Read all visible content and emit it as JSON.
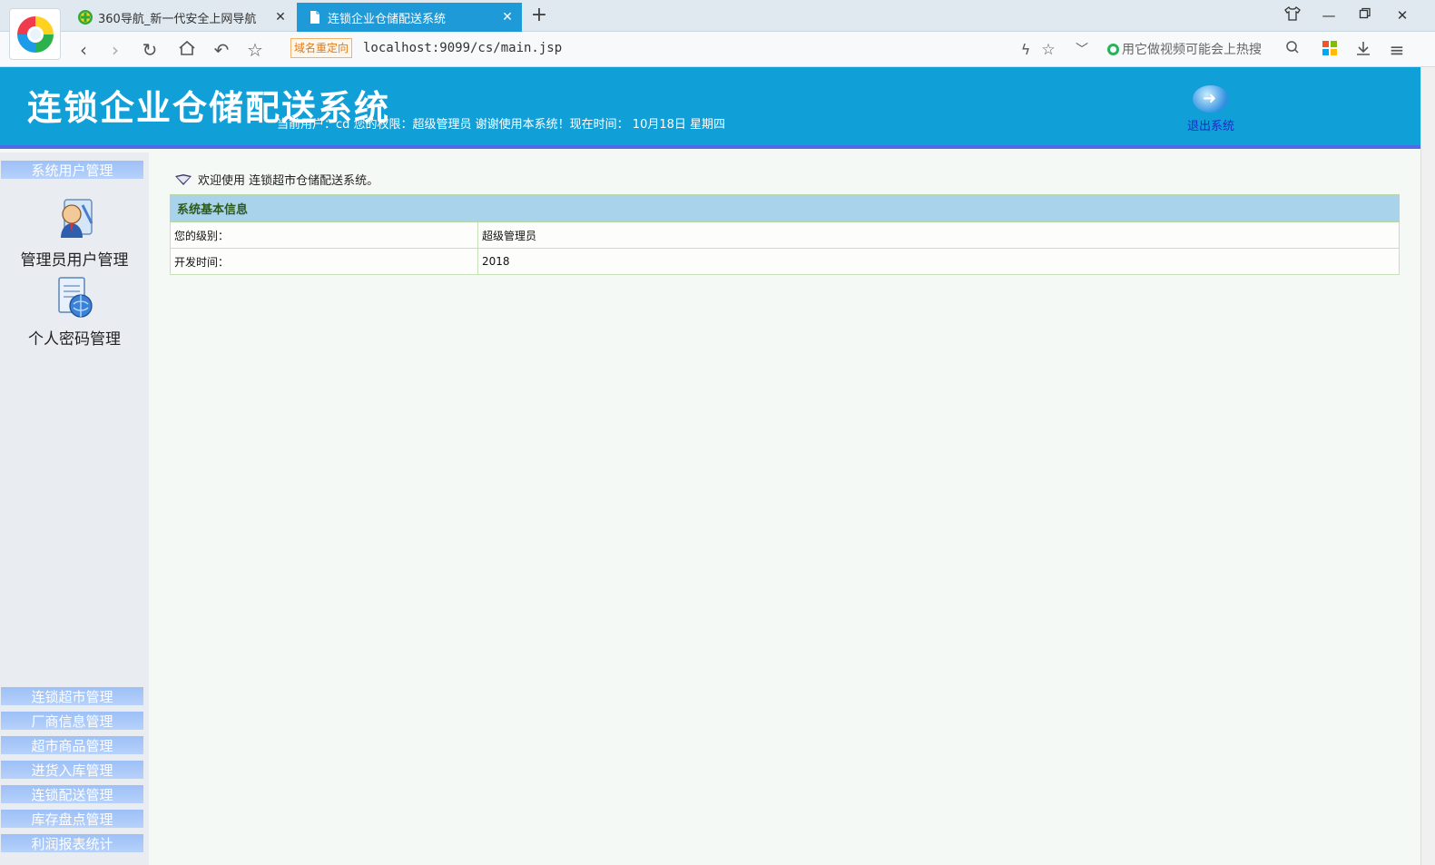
{
  "browser": {
    "tabs": [
      {
        "title": "360导航_新一代安全上网导航",
        "active": false,
        "icon": "360-plus-icon"
      },
      {
        "title": "连锁企业仓储配送系统",
        "active": true,
        "icon": "document-icon"
      }
    ],
    "redirect_badge": "域名重定向",
    "url": "localhost:9099/cs/main.jsp",
    "search_placeholder": "用它做视频可能会上热搜",
    "accent": "#1e9ad9"
  },
  "header": {
    "title": "连锁企业仓储配送系统",
    "status": "当前用户：cd 您的权限：超级管理员 谢谢使用本系统！现在时间： 10月18日 星期四",
    "logout_label": "退出系统",
    "bg_color": "#119fd8"
  },
  "sidebar": {
    "top_section": "系统用户管理",
    "items": [
      {
        "label": "管理员用户管理",
        "icon": "admin-user-icon"
      },
      {
        "label": "个人密码管理",
        "icon": "password-doc-icon"
      }
    ],
    "sections": [
      "连锁超市管理",
      "厂商信息管理",
      "超市商品管理",
      "进货入库管理",
      "连锁配送管理",
      "库存盘点管理",
      "利润报表统计"
    ]
  },
  "main": {
    "welcome": "欢迎使用 连锁超市仓储配送系统。",
    "table_title": "系统基本信息",
    "rows": [
      {
        "key": "您的级别：",
        "value": "超级管理员"
      },
      {
        "key": "开发时间：",
        "value": "2018"
      }
    ]
  }
}
